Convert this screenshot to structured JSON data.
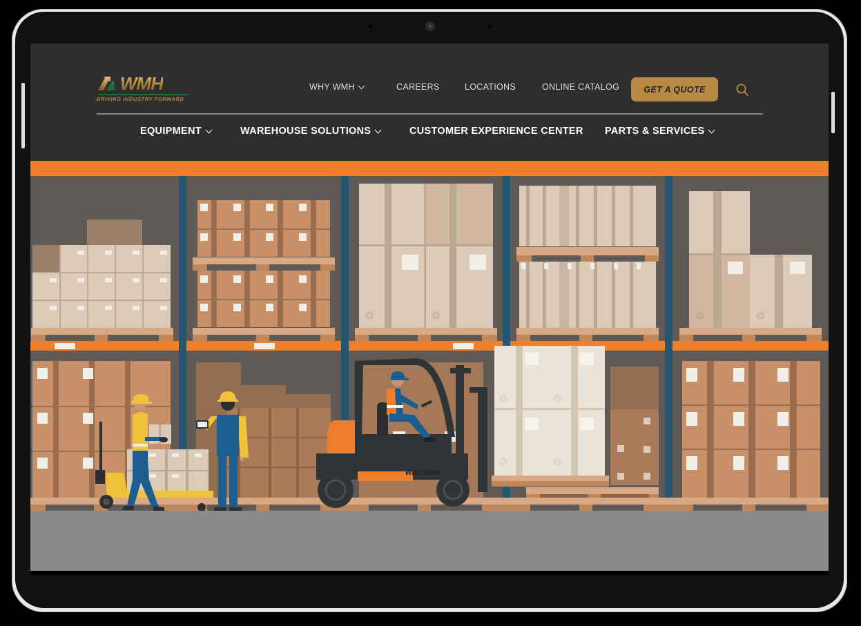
{
  "brand": {
    "name": "WMH",
    "tagline": "DRIVING INDUSTRY FORWARD",
    "colors": {
      "gold": "#b88a45",
      "green": "#1f6b3a",
      "orange": "#ed7f2c",
      "blue": "#245670",
      "header_bg": "#2e2e2e"
    }
  },
  "top_nav": {
    "items": [
      {
        "label": "WHY WMH",
        "has_dropdown": true
      },
      {
        "label": "CAREERS",
        "has_dropdown": false
      },
      {
        "label": "LOCATIONS",
        "has_dropdown": false
      },
      {
        "label": "ONLINE CATALOG",
        "has_dropdown": false
      }
    ],
    "quote_button": "GET A QUOTE",
    "search_icon": "search-icon"
  },
  "main_nav": {
    "items": [
      {
        "label": "EQUIPMENT",
        "has_dropdown": true
      },
      {
        "label": "WAREHOUSE SOLUTIONS",
        "has_dropdown": true
      },
      {
        "label": "CUSTOMER EXPERIENCE CENTER",
        "has_dropdown": false
      },
      {
        "label": "PARTS & SERVICES",
        "has_dropdown": true
      }
    ]
  },
  "hero": {
    "illustration": "warehouse-racking-with-forklift-and-workers",
    "forklift_label": "WHY WMH"
  }
}
